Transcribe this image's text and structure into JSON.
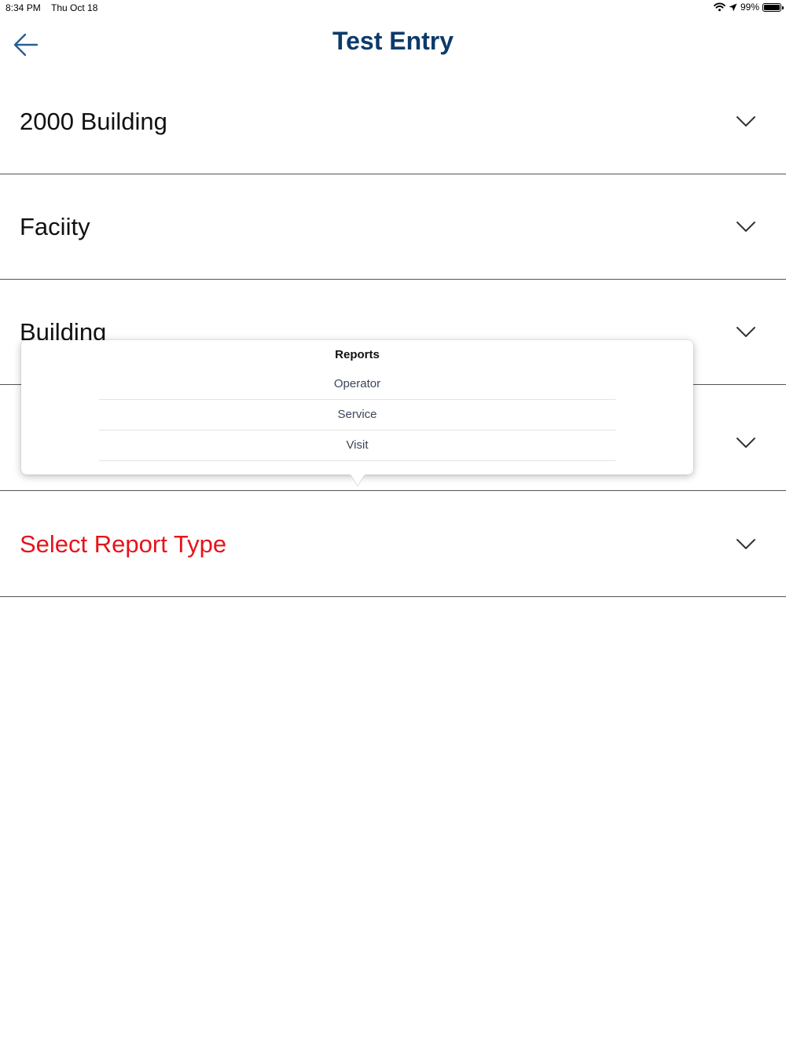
{
  "status_bar": {
    "time": "8:34 PM",
    "date": "Thu Oct 18",
    "battery": "99%",
    "battery_level": 0.99,
    "icons": [
      "wifi-icon",
      "location-arrow-icon",
      "battery-icon"
    ]
  },
  "header": {
    "title": "Test Entry",
    "back_icon": "arrow-left-icon"
  },
  "rows": [
    {
      "label": "2000 Building",
      "icon": "chevron-down-icon"
    },
    {
      "label": "Faciity",
      "icon": "chevron-down-icon"
    },
    {
      "label": "Building",
      "icon": "chevron-down-icon"
    },
    {
      "label": "",
      "icon": "chevron-down-icon"
    },
    {
      "label": "Select Report Type",
      "icon": "chevron-down-icon",
      "color": "#e6141b"
    }
  ],
  "popover": {
    "title": "Reports",
    "options": [
      "Operator",
      "Service",
      "Visit"
    ]
  },
  "colors": {
    "title": "#0c3a6b",
    "back_arrow": "#2b5f93",
    "alert_text": "#e6141b",
    "divider": "#555555",
    "popover_option_text": "#3a4658"
  }
}
